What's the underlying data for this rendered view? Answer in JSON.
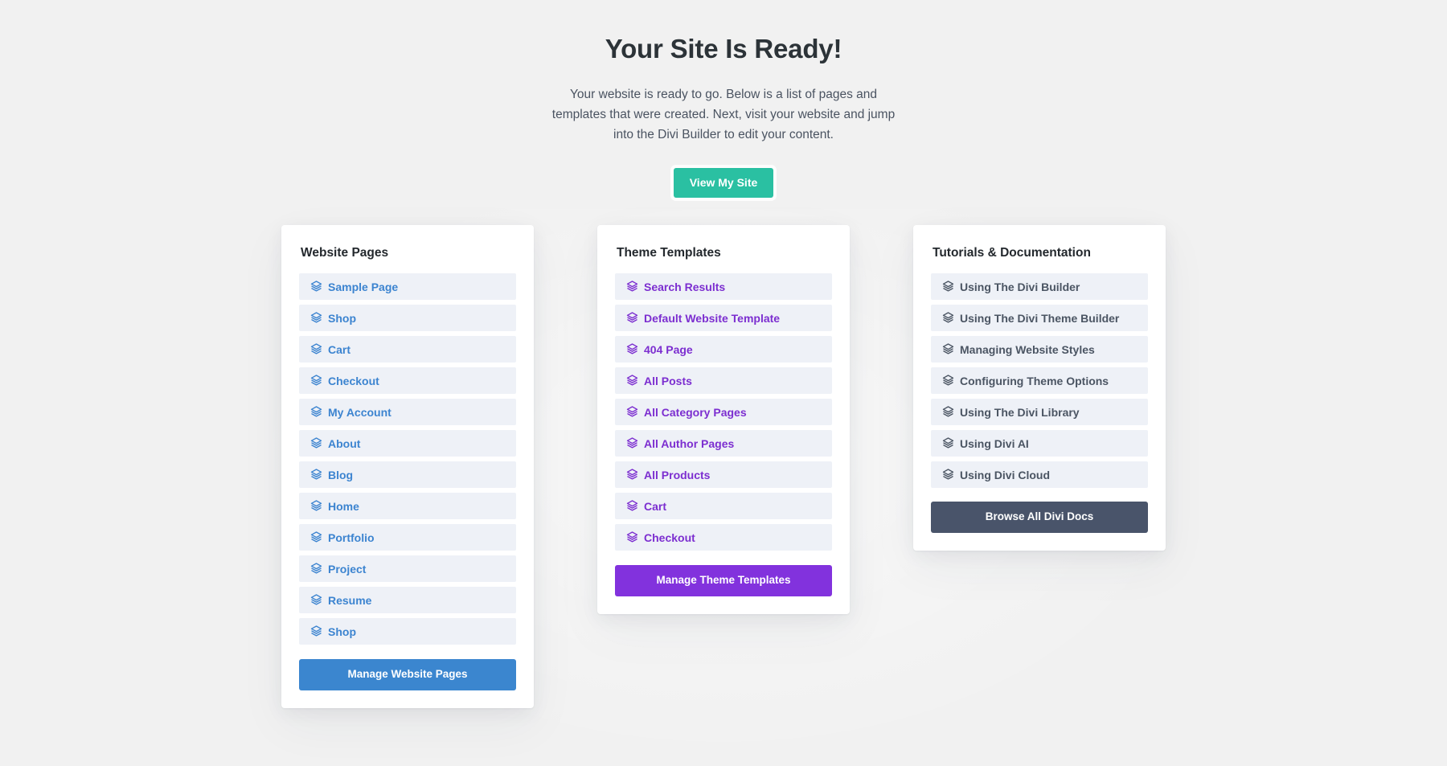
{
  "header": {
    "title": "Your Site Is Ready!",
    "subtitle": "Your website is ready to go. Below is a list of pages and templates that were created. Next, visit your website and jump into the Divi Builder to edit your content.",
    "view_site_label": "View My Site"
  },
  "colors": {
    "page_background": "#f1f1f1",
    "card_background": "#ffffff",
    "row_background": "#eef1f7",
    "title_text": "#2c3338",
    "view_site_button": "#2ac0a2",
    "pages_accent": "#3c84d0",
    "templates_accent": "#7c2ed0",
    "docs_accent": "#4b5563",
    "pages_button": "#3b86cf",
    "templates_button": "#8232dd",
    "docs_button": "#49546a"
  },
  "cards": {
    "pages": {
      "title": "Website Pages",
      "icon": "layers-icon",
      "items": [
        {
          "label": "Sample Page"
        },
        {
          "label": "Shop"
        },
        {
          "label": "Cart"
        },
        {
          "label": "Checkout"
        },
        {
          "label": "My Account"
        },
        {
          "label": "About"
        },
        {
          "label": "Blog"
        },
        {
          "label": "Home"
        },
        {
          "label": "Portfolio"
        },
        {
          "label": "Project"
        },
        {
          "label": "Resume"
        },
        {
          "label": "Shop"
        }
      ],
      "button_label": "Manage Website Pages"
    },
    "templates": {
      "title": "Theme Templates",
      "icon": "layers-icon",
      "items": [
        {
          "label": "Search Results"
        },
        {
          "label": "Default Website Template"
        },
        {
          "label": "404 Page"
        },
        {
          "label": "All Posts"
        },
        {
          "label": "All Category Pages"
        },
        {
          "label": "All Author Pages"
        },
        {
          "label": "All Products"
        },
        {
          "label": "Cart"
        },
        {
          "label": "Checkout"
        }
      ],
      "button_label": "Manage Theme Templates"
    },
    "docs": {
      "title": "Tutorials & Documentation",
      "icon": "layers-icon",
      "items": [
        {
          "label": "Using The Divi Builder"
        },
        {
          "label": "Using The Divi Theme Builder"
        },
        {
          "label": "Managing Website Styles"
        },
        {
          "label": "Configuring Theme Options"
        },
        {
          "label": "Using The Divi Library"
        },
        {
          "label": "Using Divi AI"
        },
        {
          "label": "Using Divi Cloud"
        }
      ],
      "button_label": "Browse All Divi Docs"
    }
  }
}
